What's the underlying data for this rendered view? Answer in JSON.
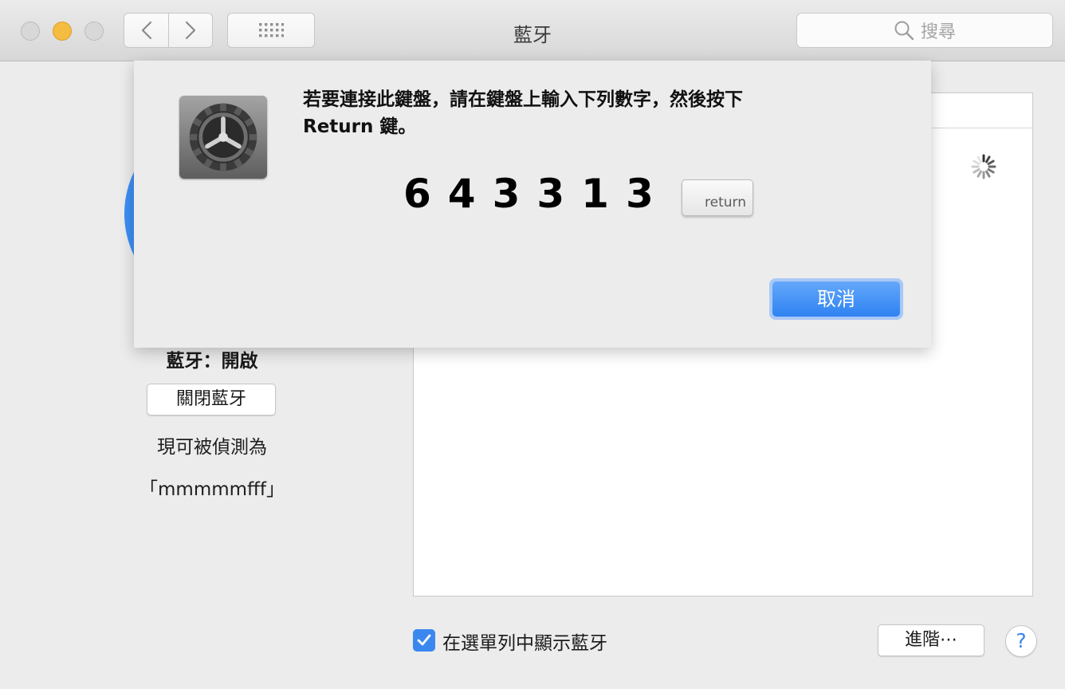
{
  "window": {
    "title": "藍牙",
    "search_placeholder": "搜尋"
  },
  "bluetooth": {
    "status": "藍牙：開啟",
    "toggle_button": "關閉藍牙",
    "discoverable_line1": "現可被偵測為",
    "discoverable_line2": "「mmmmmfff」",
    "show_in_menubar_label": "在選單列中顯示藍牙",
    "show_in_menubar_checked": true,
    "advanced_button": "進階⋯",
    "help_button": "?"
  },
  "dialog": {
    "message_line1": "若要連接此鍵盤，請在鍵盤上輸入下列數字，然後按下",
    "message_line2": "Return 鍵。",
    "passkey": "643313",
    "return_key_label": "return",
    "cancel_button": "取消"
  },
  "colors": {
    "accent": "#3b87f0",
    "bluetooth_blue": "#3d8ef3",
    "traffic_light_minimize": "#f4bc41"
  },
  "icons": [
    "back-arrow-icon",
    "forward-arrow-icon",
    "show-all-grid-icon",
    "search-icon",
    "system-preferences-gear-icon",
    "loading-spinner-icon",
    "checkmark-icon"
  ]
}
